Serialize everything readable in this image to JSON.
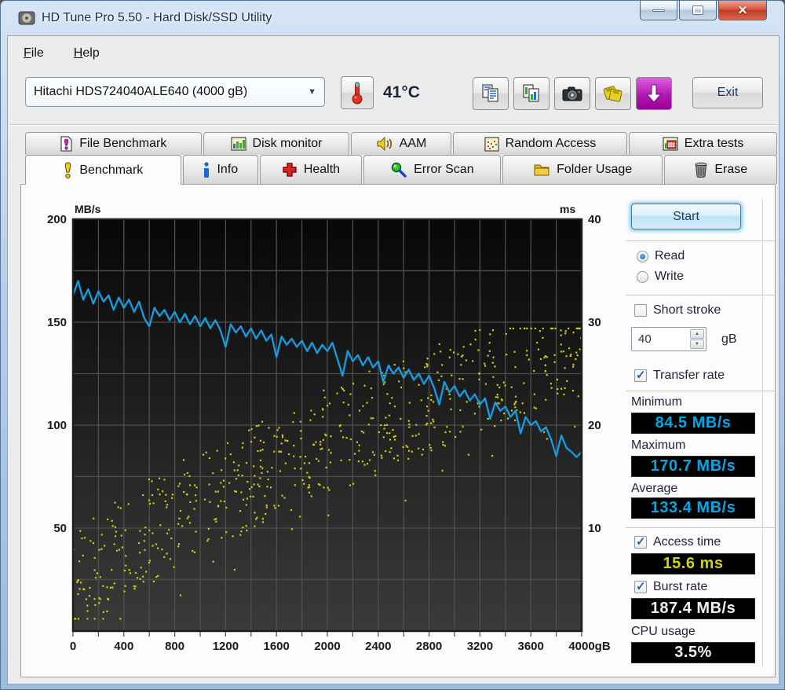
{
  "window": {
    "title": "HD Tune Pro 5.50 - Hard Disk/SSD Utility"
  },
  "menu": {
    "items": [
      {
        "label": "File"
      },
      {
        "label": "Help"
      }
    ]
  },
  "toolbar": {
    "drive_selector_value": "Hitachi HDS724040ALE640 (4000 gB)",
    "temperature": "41°C",
    "icon_buttons": [
      "thermometer",
      "copy-text",
      "copy-image",
      "camera",
      "save-disks",
      "download-arrow"
    ],
    "exit_label": "Exit"
  },
  "tabs": {
    "active": "Benchmark",
    "row1": [
      {
        "label": "File Benchmark",
        "icon": "file-exclamation"
      },
      {
        "label": "Disk monitor",
        "icon": "bar-chart"
      },
      {
        "label": "AAM",
        "icon": "speaker"
      },
      {
        "label": "Random Access",
        "icon": "scatter-dots"
      },
      {
        "label": "Extra tests",
        "icon": "mini-chart"
      }
    ],
    "row2": [
      {
        "label": "Benchmark",
        "icon": "exclamation"
      },
      {
        "label": "Info",
        "icon": "info-i"
      },
      {
        "label": "Health",
        "icon": "red-cross"
      },
      {
        "label": "Error Scan",
        "icon": "magnifier"
      },
      {
        "label": "Folder Usage",
        "icon": "folder"
      },
      {
        "label": "Erase",
        "icon": "trash"
      }
    ]
  },
  "benchmark_panel": {
    "start_label": "Start",
    "read_label": "Read",
    "write_label": "Write",
    "short_stroke_label": "Short stroke",
    "short_stroke_value": "40",
    "short_stroke_unit": "gB",
    "transfer_rate_label": "Transfer rate",
    "minimum_label": "Minimum",
    "minimum_value": "84.5 MB/s",
    "maximum_label": "Maximum",
    "maximum_value": "170.7 MB/s",
    "average_label": "Average",
    "average_value": "133.4 MB/s",
    "access_time_label": "Access time",
    "access_time_value": "15.6 ms",
    "burst_rate_label": "Burst rate",
    "burst_rate_value": "187.4 MB/s",
    "cpu_usage_label": "CPU usage",
    "cpu_usage_value": "3.5%",
    "states": {
      "read": true,
      "write": false,
      "short_stroke": false,
      "transfer_rate": true,
      "access_time": true,
      "burst_rate": true
    }
  },
  "chart_data": {
    "type": "line+scatter",
    "left_axis": {
      "unit": "MB/s",
      "range": [
        0,
        200
      ],
      "ticks": [
        200,
        150,
        100,
        50
      ],
      "grid_step": 25
    },
    "right_axis": {
      "unit": "ms",
      "range": [
        0,
        40
      ],
      "ticks": [
        40,
        30,
        20,
        10
      ]
    },
    "x_axis": {
      "range": [
        0,
        4000
      ],
      "grid_step": 200,
      "tick_step": 200,
      "labels": [
        "0",
        "400",
        "800",
        "1200",
        "1600",
        "2000",
        "2400",
        "2800",
        "3200",
        "3600",
        "4000gB"
      ]
    },
    "colors": {
      "line": "#1f9ede",
      "scatter": "#cbcb17",
      "grid": "#4f4f4f",
      "bg_top": "#070707",
      "bg_bottom": "#3a3a3a"
    },
    "series": [
      {
        "name": "transfer_rate",
        "type": "line",
        "axis": "left",
        "points": [
          [
            0,
            163
          ],
          [
            40,
            170
          ],
          [
            80,
            161
          ],
          [
            120,
            166
          ],
          [
            160,
            159
          ],
          [
            200,
            165
          ],
          [
            240,
            160
          ],
          [
            280,
            163
          ],
          [
            320,
            156
          ],
          [
            360,
            162
          ],
          [
            400,
            157
          ],
          [
            440,
            161
          ],
          [
            480,
            155
          ],
          [
            520,
            160
          ],
          [
            560,
            152
          ],
          [
            600,
            148
          ],
          [
            640,
            157
          ],
          [
            680,
            153
          ],
          [
            720,
            156
          ],
          [
            760,
            151
          ],
          [
            800,
            155
          ],
          [
            840,
            150
          ],
          [
            880,
            154
          ],
          [
            920,
            149
          ],
          [
            960,
            153
          ],
          [
            1000,
            148
          ],
          [
            1040,
            152
          ],
          [
            1080,
            147
          ],
          [
            1120,
            151
          ],
          [
            1160,
            146
          ],
          [
            1200,
            138
          ],
          [
            1240,
            149
          ],
          [
            1280,
            145
          ],
          [
            1320,
            148
          ],
          [
            1360,
            143
          ],
          [
            1400,
            147
          ],
          [
            1440,
            142
          ],
          [
            1480,
            146
          ],
          [
            1520,
            141
          ],
          [
            1560,
            144
          ],
          [
            1600,
            133
          ],
          [
            1640,
            143
          ],
          [
            1680,
            139
          ],
          [
            1720,
            142
          ],
          [
            1760,
            138
          ],
          [
            1800,
            141
          ],
          [
            1840,
            136
          ],
          [
            1880,
            140
          ],
          [
            1920,
            135
          ],
          [
            1960,
            139
          ],
          [
            2000,
            136
          ],
          [
            2040,
            140
          ],
          [
            2080,
            132
          ],
          [
            2120,
            124
          ],
          [
            2160,
            136
          ],
          [
            2200,
            131
          ],
          [
            2240,
            134
          ],
          [
            2280,
            129
          ],
          [
            2320,
            133
          ],
          [
            2360,
            128
          ],
          [
            2400,
            131
          ],
          [
            2440,
            121
          ],
          [
            2480,
            129
          ],
          [
            2520,
            125
          ],
          [
            2560,
            128
          ],
          [
            2600,
            123
          ],
          [
            2640,
            127
          ],
          [
            2680,
            122
          ],
          [
            2720,
            125
          ],
          [
            2760,
            120
          ],
          [
            2800,
            124
          ],
          [
            2840,
            118
          ],
          [
            2880,
            110
          ],
          [
            2920,
            121
          ],
          [
            2960,
            116
          ],
          [
            3000,
            119
          ],
          [
            3040,
            114
          ],
          [
            3080,
            117
          ],
          [
            3120,
            112
          ],
          [
            3160,
            115
          ],
          [
            3200,
            110
          ],
          [
            3240,
            113
          ],
          [
            3280,
            103
          ],
          [
            3320,
            111
          ],
          [
            3360,
            107
          ],
          [
            3400,
            109
          ],
          [
            3440,
            104
          ],
          [
            3480,
            107
          ],
          [
            3520,
            96
          ],
          [
            3560,
            104
          ],
          [
            3600,
            100
          ],
          [
            3640,
            102
          ],
          [
            3680,
            97
          ],
          [
            3720,
            99
          ],
          [
            3760,
            93
          ],
          [
            3800,
            85
          ],
          [
            3840,
            95
          ],
          [
            3880,
            89
          ],
          [
            3920,
            87
          ],
          [
            3960,
            84.5
          ],
          [
            4000,
            87
          ]
        ]
      },
      {
        "name": "access_time",
        "type": "scatter",
        "axis": "right",
        "model": {
          "count": 640,
          "seed": 1337,
          "center_base": 3.5,
          "center_gain": 24.5,
          "center_exp": 0.72,
          "spread": 5.2,
          "low_outlier_chance": 0.08,
          "low_outlier_extra": 6,
          "min_ms": 1.2,
          "max_ms": 29.4
        }
      }
    ]
  }
}
